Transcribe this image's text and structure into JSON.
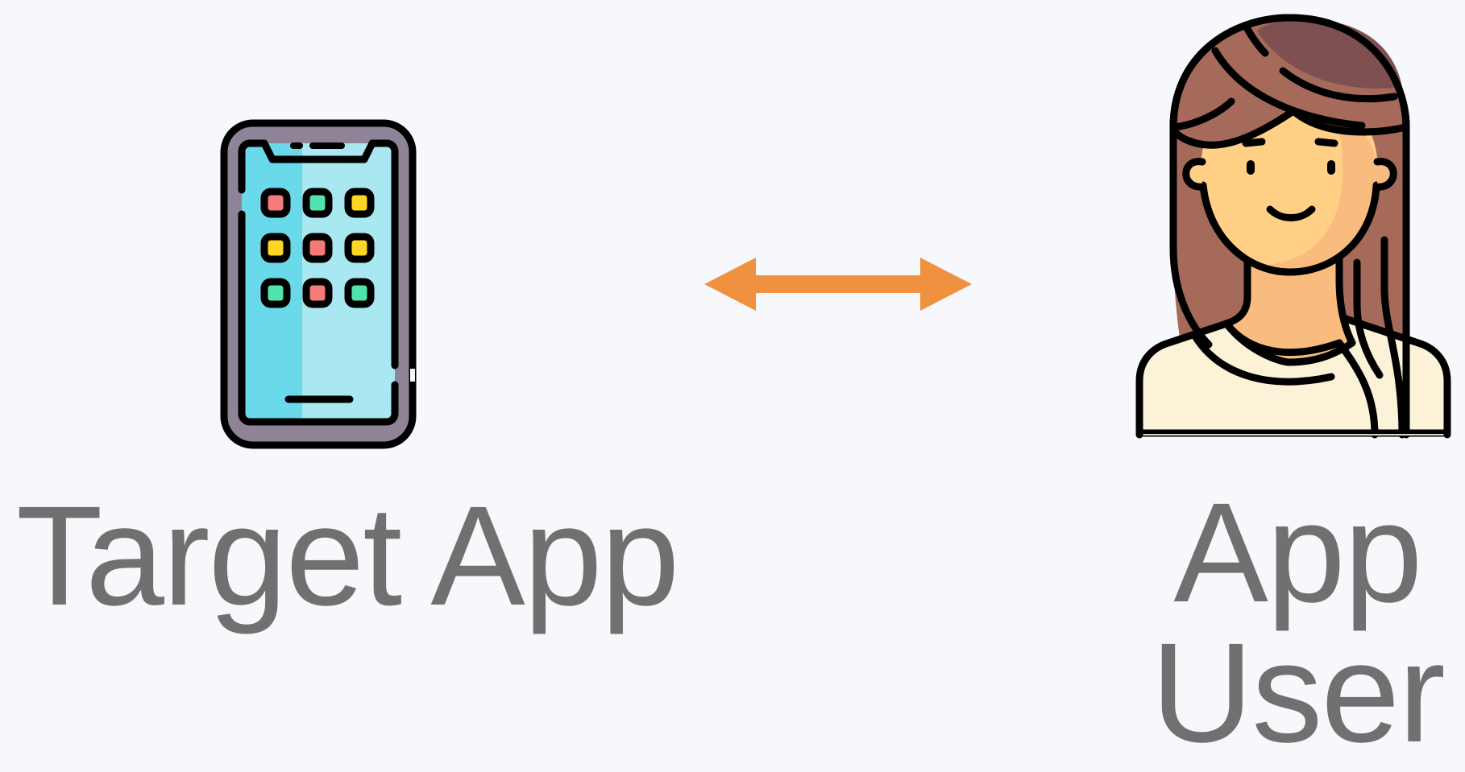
{
  "nodes": {
    "target_app": {
      "label": "Target App",
      "icon": "smartphone-icon"
    },
    "app_user": {
      "label": "App User",
      "icon": "female-user-avatar-icon"
    }
  },
  "connector": {
    "type": "bidirectional-arrow",
    "icon": "double-headed-arrow-icon"
  },
  "colors": {
    "background": "#f7f8fc",
    "label_text": "#707070",
    "arrow": "#f0913f",
    "phone_frame": "#8f8497",
    "phone_screen_left": "#6ad9e9",
    "phone_screen_right": "#a9e8f1",
    "app_tile_red": "#f57a78",
    "app_tile_green": "#4fe3ae",
    "app_tile_yellow": "#ffd524",
    "hair": "#a56a59",
    "hair_dark": "#7f5052",
    "skin": "#ffd086",
    "skin_shadow": "#f9bb7e",
    "shirt": "#fbf2d8",
    "outline": "#000000"
  }
}
